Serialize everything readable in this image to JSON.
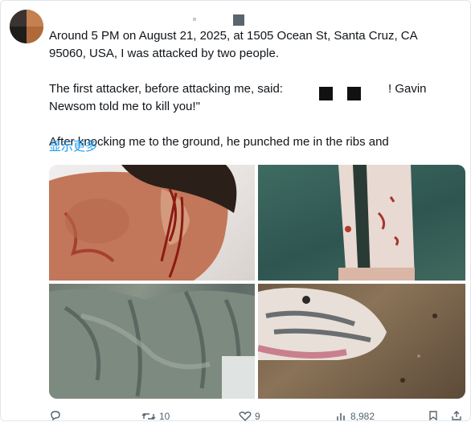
{
  "tweet": {
    "paragraph1": "Around 5 PM on August 21, 2025, at 1505 Ocean St, Santa Cruz, CA 95060, USA, I was attacked by two people.",
    "paragraph2_start": "The first attacker, before attacking me, said:",
    "paragraph2_mid": "! Gavin",
    "paragraph2_end": "Newsom told me to kill you!\"",
    "paragraph3": "After knocking me to the ground, he punched me in the ribs and",
    "show_more": "显示更多"
  },
  "photos": [
    {
      "name": "injured-face-photo"
    },
    {
      "name": "bloody-leg-photo"
    },
    {
      "name": "torn-jacket-photo"
    },
    {
      "name": "shoe-on-ground-photo"
    }
  ],
  "actions": {
    "reply": {
      "icon": "reply-icon",
      "count": ""
    },
    "retweet": {
      "icon": "retweet-icon",
      "count": "10"
    },
    "like": {
      "icon": "heart-icon",
      "count": "9"
    },
    "views": {
      "icon": "views-icon",
      "count": "8,982"
    },
    "bookmark": {
      "icon": "bookmark-icon",
      "count": ""
    }
  },
  "colors": {
    "link": "#1d9bf0",
    "text": "#0f1419",
    "muted": "#536471"
  }
}
